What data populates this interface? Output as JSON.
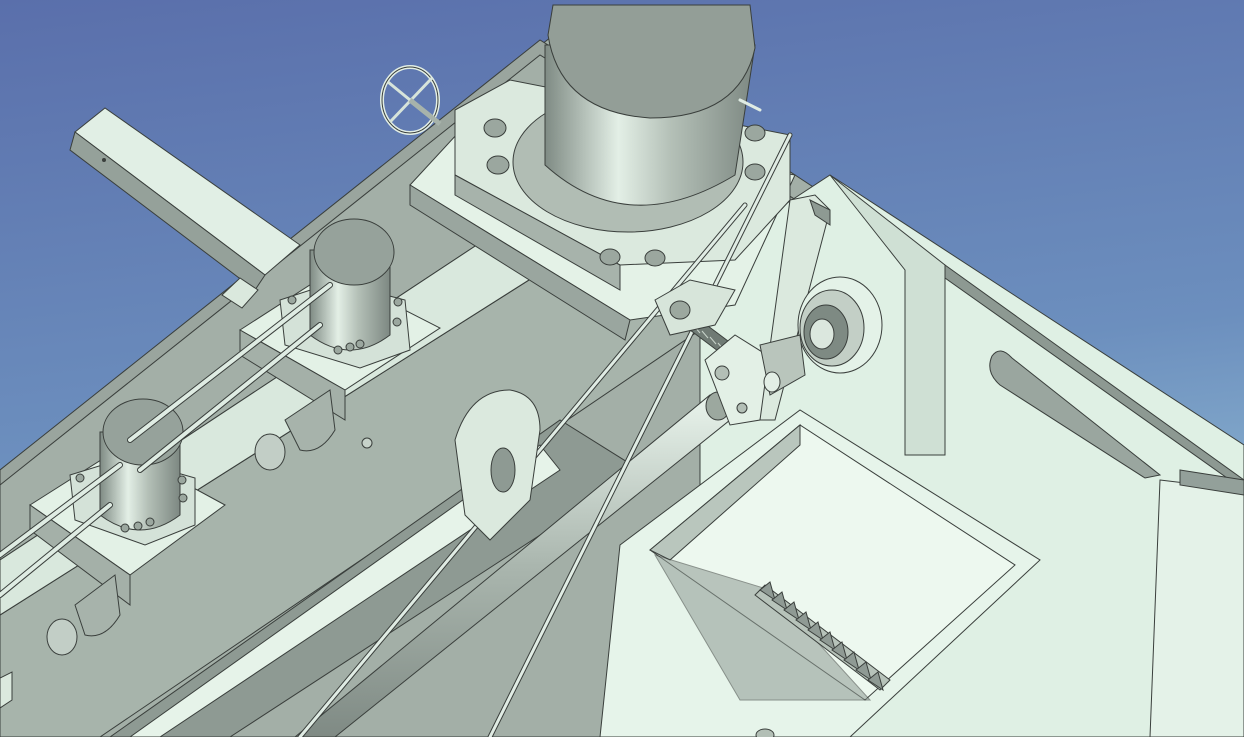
{
  "viewport": {
    "background_top": "#5a73ad",
    "background_bottom": "#93bbd4",
    "model_face_light": "#e8f5ea",
    "model_face_mid": "#a9b6ac",
    "model_face_dark": "#8e9a93",
    "edge_color": "#3a3f3c"
  },
  "parts": [
    {
      "name": "handwheel-icon"
    },
    {
      "name": "large-cylinder"
    },
    {
      "name": "small-cylinder-1"
    },
    {
      "name": "small-cylinder-2"
    },
    {
      "name": "lead-screw"
    },
    {
      "name": "bearing-housing"
    },
    {
      "name": "rack-gear"
    },
    {
      "name": "hopper-box"
    },
    {
      "name": "guide-rods"
    },
    {
      "name": "frame-rail"
    }
  ]
}
